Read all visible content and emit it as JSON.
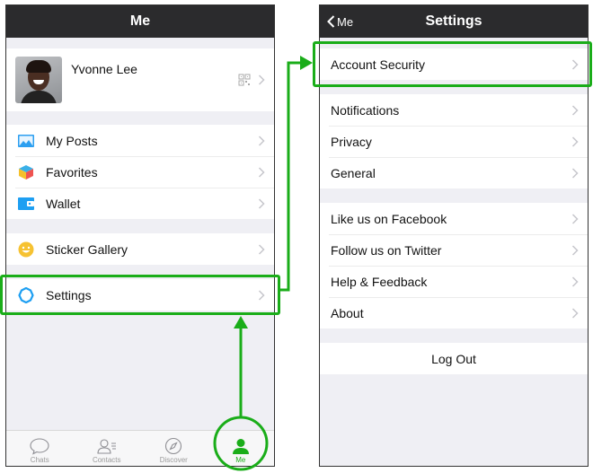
{
  "me_screen": {
    "title": "Me",
    "profile": {
      "name": "Yvonne Lee",
      "qr_icon": "qr-code-icon"
    },
    "groups": [
      [
        {
          "label": "My Posts",
          "icon": "photo-album-icon"
        },
        {
          "label": "Favorites",
          "icon": "cube-icon"
        },
        {
          "label": "Wallet",
          "icon": "wallet-icon"
        }
      ],
      [
        {
          "label": "Sticker Gallery",
          "icon": "smiley-icon"
        }
      ],
      [
        {
          "label": "Settings",
          "icon": "gear-icon"
        }
      ]
    ],
    "tabbar": [
      {
        "label": "Chats",
        "icon": "chat-bubble-icon",
        "active": false
      },
      {
        "label": "Contacts",
        "icon": "contacts-icon",
        "active": false
      },
      {
        "label": "Discover",
        "icon": "compass-icon",
        "active": false
      },
      {
        "label": "Me",
        "icon": "person-icon",
        "active": true
      }
    ]
  },
  "settings_screen": {
    "back_label": "Me",
    "title": "Settings",
    "groups": [
      [
        {
          "label": "Account Security"
        }
      ],
      [
        {
          "label": "Notifications"
        },
        {
          "label": "Privacy"
        },
        {
          "label": "General"
        }
      ],
      [
        {
          "label": "Like us on Facebook"
        },
        {
          "label": "Follow us on Twitter"
        },
        {
          "label": "Help & Feedback"
        },
        {
          "label": "About"
        }
      ]
    ],
    "logout_label": "Log Out"
  },
  "colors": {
    "accent_green": "#1aad19",
    "navbar": "#2b2b2d",
    "background": "#efeff4"
  }
}
